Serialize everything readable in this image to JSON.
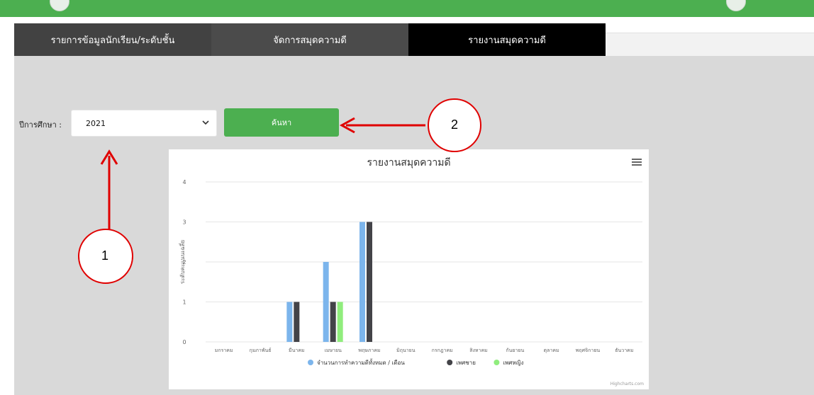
{
  "tabs": [
    {
      "label": "รายการข้อมูลนักเรียน/ระดับชั้น"
    },
    {
      "label": "จัดการสมุดความดี"
    },
    {
      "label": "รายงานสมุดความดี"
    }
  ],
  "filter": {
    "year_label": "ปีการศึกษา :",
    "year_value": "2021",
    "search_label": "ค้นหา"
  },
  "annotations": {
    "callout_1": "1",
    "callout_2": "2"
  },
  "colors": {
    "topbar": "#4caf50",
    "button": "#4caf50",
    "series_total": "#7cb5ec",
    "series_male": "#434348",
    "series_female": "#90ed7d",
    "annotation": "#e00000"
  },
  "icons": {
    "menu": "hamburger-menu-icon",
    "select": "chevron-down-icon"
  },
  "chart_data": {
    "type": "bar",
    "title": "รายงานสมุดความดี",
    "ylabel": "ระดับคะแนนเฉลี่ย",
    "xlabel": "",
    "ylim": [
      0,
      4
    ],
    "yticks": [
      0,
      1,
      2,
      3,
      4
    ],
    "categories": [
      "มกราคม",
      "กุมภาพันธ์",
      "มีนาคม",
      "เมษายน",
      "พฤษภาคม",
      "มิถุนายน",
      "กรกฎาคม",
      "สิงหาคม",
      "กันยายน",
      "ตุลาคม",
      "พฤศจิกายน",
      "ธันวาคม"
    ],
    "series": [
      {
        "name": "จำนวนการทำความดีทั้งหมด / เดือน",
        "color": "#7cb5ec",
        "values": [
          0,
          0,
          1,
          2,
          3,
          0,
          0,
          0,
          0,
          0,
          0,
          0
        ]
      },
      {
        "name": "เพศชาย",
        "color": "#434348",
        "values": [
          0,
          0,
          1,
          1,
          3,
          0,
          0,
          0,
          0,
          0,
          0,
          0
        ]
      },
      {
        "name": "เพศหญิง",
        "color": "#90ed7d",
        "values": [
          0,
          0,
          0,
          1,
          0,
          0,
          0,
          0,
          0,
          0,
          0,
          0
        ]
      }
    ],
    "legend_position": "bottom",
    "grid": true,
    "credit": "Highcharts.com"
  }
}
